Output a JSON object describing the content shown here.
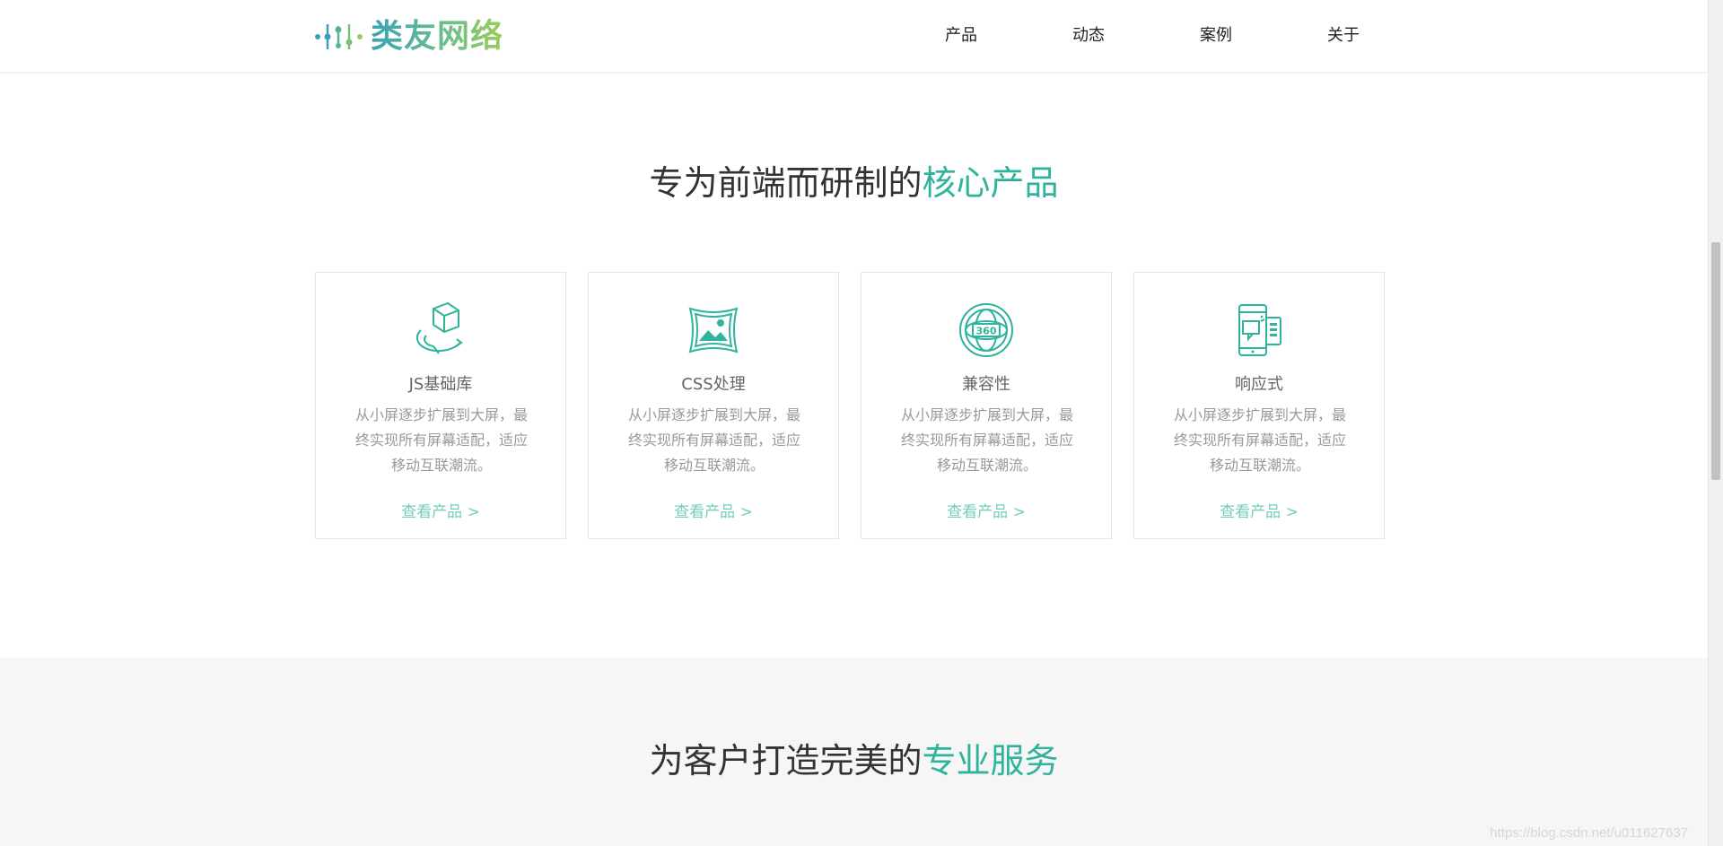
{
  "header": {
    "logo_text": "类友网络",
    "nav": [
      {
        "label": "产品"
      },
      {
        "label": "动态"
      },
      {
        "label": "案例"
      },
      {
        "label": "关于"
      }
    ]
  },
  "products_section": {
    "title_plain": "专为前端而研制的",
    "title_accent": "核心产品",
    "cards": [
      {
        "icon": "cube-rotate-icon",
        "title": "JS基础库",
        "desc": "从小屏逐步扩展到大屏，最终实现所有屏幕适配，适应移动互联潮流。",
        "link": "查看产品 >"
      },
      {
        "icon": "image-frame-icon",
        "title": "CSS处理",
        "desc": "从小屏逐步扩展到大屏，最终实现所有屏幕适配，适应移动互联潮流。",
        "link": "查看产品 >"
      },
      {
        "icon": "globe-360-icon",
        "title": "兼容性",
        "desc": "从小屏逐步扩展到大屏，最终实现所有屏幕适配，适应移动互联潮流。",
        "link": "查看产品 >"
      },
      {
        "icon": "responsive-devices-icon",
        "title": "响应式",
        "desc": "从小屏逐步扩展到大屏，最终实现所有屏幕适配，适应移动互联潮流。",
        "link": "查看产品 >"
      }
    ]
  },
  "services_section": {
    "title_plain": "为客户打造完美的",
    "title_accent": "专业服务"
  },
  "watermark": "https://blog.csdn.net/u011627637",
  "colors": {
    "accent": "#2fb39d",
    "link": "#6fcfb9",
    "section_alt_bg": "#f6f6f6"
  }
}
